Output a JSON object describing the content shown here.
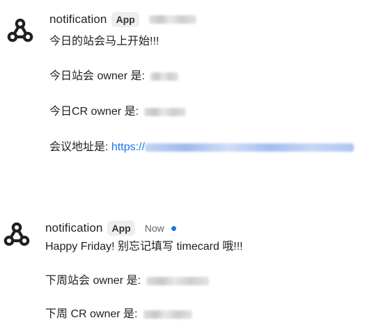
{
  "messages": [
    {
      "sender": "notification",
      "badge": "App",
      "icon": "webhook-icon",
      "lines": [
        "今日的站会马上开始!!!",
        "今日站会 owner 是:",
        "今日CR owner 是:",
        "会议地址是:"
      ],
      "link_prefix": "https://"
    },
    {
      "sender": "notification",
      "badge": "App",
      "timestamp": "Now",
      "icon": "webhook-icon",
      "unread_color": "#1a73e8",
      "lines": [
        "Happy Friday! 别忘记填写 timecard 哦!!!",
        "下周站会 owner 是:",
        "下周 CR owner 是:"
      ]
    }
  ],
  "colors": {
    "link": "#1a73e8",
    "badge_bg": "#eeeeef",
    "text": "#1f1f1f"
  }
}
